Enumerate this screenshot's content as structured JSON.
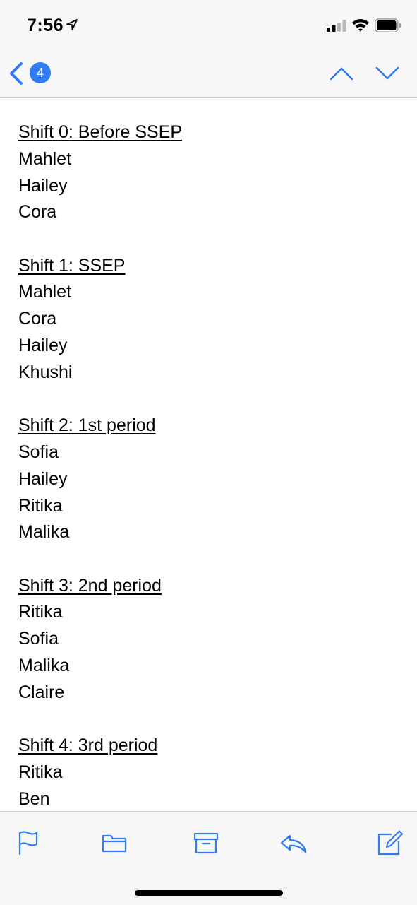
{
  "status_bar": {
    "time": "7:56",
    "icons": [
      "location-arrow-icon",
      "cellular-signal-icon",
      "wifi-icon",
      "battery-icon"
    ]
  },
  "nav_bar": {
    "unread_count": "4",
    "icons": [
      "chevron-left-icon",
      "chevron-up-icon",
      "chevron-down-icon"
    ],
    "accent_color": "#2f7cf6"
  },
  "message": {
    "shifts": [
      {
        "heading": "Shift 0: Before SSEP",
        "names": [
          "Mahlet",
          "Hailey",
          "Cora"
        ]
      },
      {
        "heading": "Shift 1: SSEP",
        "names": [
          "Mahlet",
          "Cora",
          "Hailey",
          "Khushi"
        ]
      },
      {
        "heading": "Shift 2: 1st period",
        "names": [
          "Sofia",
          "Hailey",
          "Ritika",
          "Malika"
        ]
      },
      {
        "heading": "Shift 3: 2nd period",
        "names": [
          "Ritika",
          "Sofia",
          "Malika",
          "Claire"
        ]
      },
      {
        "heading": "Shift 4: 3rd period",
        "names": [
          "Ritika",
          "Ben"
        ]
      }
    ]
  },
  "toolbar": {
    "icons": [
      "flag-icon",
      "folder-icon",
      "archive-icon",
      "reply-icon",
      "compose-icon"
    ]
  }
}
